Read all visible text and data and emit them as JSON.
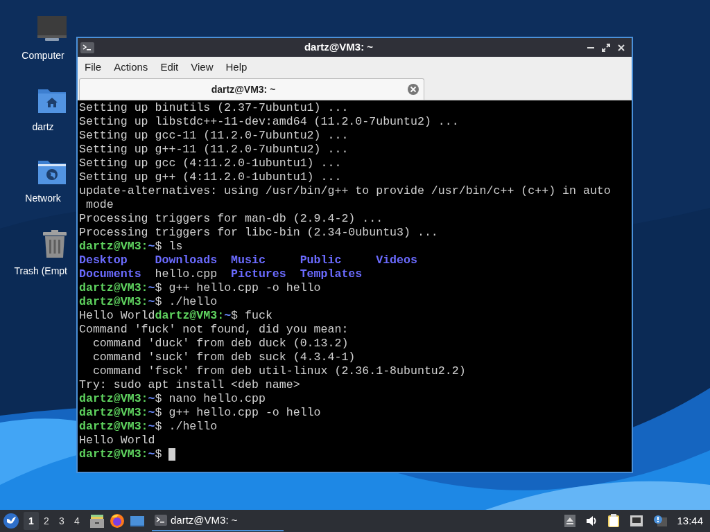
{
  "desktop_icons": [
    {
      "kind": "computer",
      "label": "Computer"
    },
    {
      "kind": "home",
      "label": "dartz"
    },
    {
      "kind": "network",
      "label": "Network"
    },
    {
      "kind": "trash",
      "label": "Trash (Empt"
    }
  ],
  "window": {
    "title": "dartz@VM3: ~",
    "menu": [
      "File",
      "Actions",
      "Edit",
      "View",
      "Help"
    ],
    "tabs": [
      {
        "label": "dartz@VM3: ~",
        "selected": true
      }
    ],
    "terminal": [
      {
        "kind": "output",
        "text": "Setting up binutils (2.37-7ubuntu1) ..."
      },
      {
        "kind": "output",
        "text": "Setting up libstdc++-11-dev:amd64 (11.2.0-7ubuntu2) ..."
      },
      {
        "kind": "output",
        "text": "Setting up gcc-11 (11.2.0-7ubuntu2) ..."
      },
      {
        "kind": "output",
        "text": "Setting up g++-11 (11.2.0-7ubuntu2) ..."
      },
      {
        "kind": "output",
        "text": "Setting up gcc (4:11.2.0-1ubuntu1) ..."
      },
      {
        "kind": "output",
        "text": "Setting up g++ (4:11.2.0-1ubuntu1) ..."
      },
      {
        "kind": "output",
        "text": "update-alternatives: using /usr/bin/g++ to provide /usr/bin/c++ (c++) in auto"
      },
      {
        "kind": "output",
        "text": " mode"
      },
      {
        "kind": "output",
        "text": "Processing triggers for man-db (2.9.4-2) ..."
      },
      {
        "kind": "output",
        "text": "Processing triggers for libc-bin (2.34-0ubuntu3) ..."
      },
      {
        "kind": "prompt",
        "user": "dartz@VM3:",
        "path": "~",
        "command": "$ ls"
      },
      {
        "kind": "listing",
        "entries": [
          {
            "kind": "dir",
            "name": "Desktop"
          },
          {
            "kind": "dir",
            "name": "Downloads"
          },
          {
            "kind": "dir",
            "name": "Music"
          },
          {
            "kind": "dir",
            "name": "Public"
          },
          {
            "kind": "dir",
            "name": "Videos"
          }
        ]
      },
      {
        "kind": "listing",
        "entries": [
          {
            "kind": "dir",
            "name": "Documents"
          },
          {
            "kind": "file",
            "name": "hello.cpp"
          },
          {
            "kind": "dir",
            "name": "Pictures"
          },
          {
            "kind": "dir",
            "name": "Templates"
          }
        ]
      },
      {
        "kind": "prompt",
        "user": "dartz@VM3:",
        "path": "~",
        "command": "$ g++ hello.cpp -o hello"
      },
      {
        "kind": "prompt",
        "user": "dartz@VM3:",
        "path": "~",
        "command": "$ ./hello"
      },
      {
        "kind": "prompt",
        "prefix": "Hello World",
        "user": "dartz@VM3:",
        "path": "~",
        "command": "$ fuck"
      },
      {
        "kind": "output",
        "text": "Command 'fuck' not found, did you mean:"
      },
      {
        "kind": "output",
        "text": "  command 'duck' from deb duck (0.13.2)"
      },
      {
        "kind": "output",
        "text": "  command 'suck' from deb suck (4.3.4-1)"
      },
      {
        "kind": "output",
        "text": "  command 'fsck' from deb util-linux (2.36.1-8ubuntu2.2)"
      },
      {
        "kind": "output",
        "text": "Try: sudo apt install <deb name>"
      },
      {
        "kind": "prompt",
        "user": "dartz@VM3:",
        "path": "~",
        "command": "$ nano hello.cpp"
      },
      {
        "kind": "prompt",
        "user": "dartz@VM3:",
        "path": "~",
        "command": "$ g++ hello.cpp -o hello"
      },
      {
        "kind": "prompt",
        "user": "dartz@VM3:",
        "path": "~",
        "command": "$ ./hello"
      },
      {
        "kind": "output",
        "text": "Hello World"
      },
      {
        "kind": "prompt",
        "user": "dartz@VM3:",
        "path": "~",
        "command": "$ ",
        "cursor": true
      }
    ]
  },
  "taskbar": {
    "workspaces": [
      {
        "label": "1",
        "selected": true
      },
      {
        "label": "2",
        "selected": false
      },
      {
        "label": "3",
        "selected": false
      },
      {
        "label": "4",
        "selected": false
      }
    ],
    "launchers": [
      {
        "kind": "files"
      },
      {
        "kind": "browser"
      },
      {
        "kind": "desktop"
      }
    ],
    "tasks": [
      {
        "label": "dartz@VM3: ~",
        "selected": true
      }
    ],
    "clock": "13:44"
  }
}
